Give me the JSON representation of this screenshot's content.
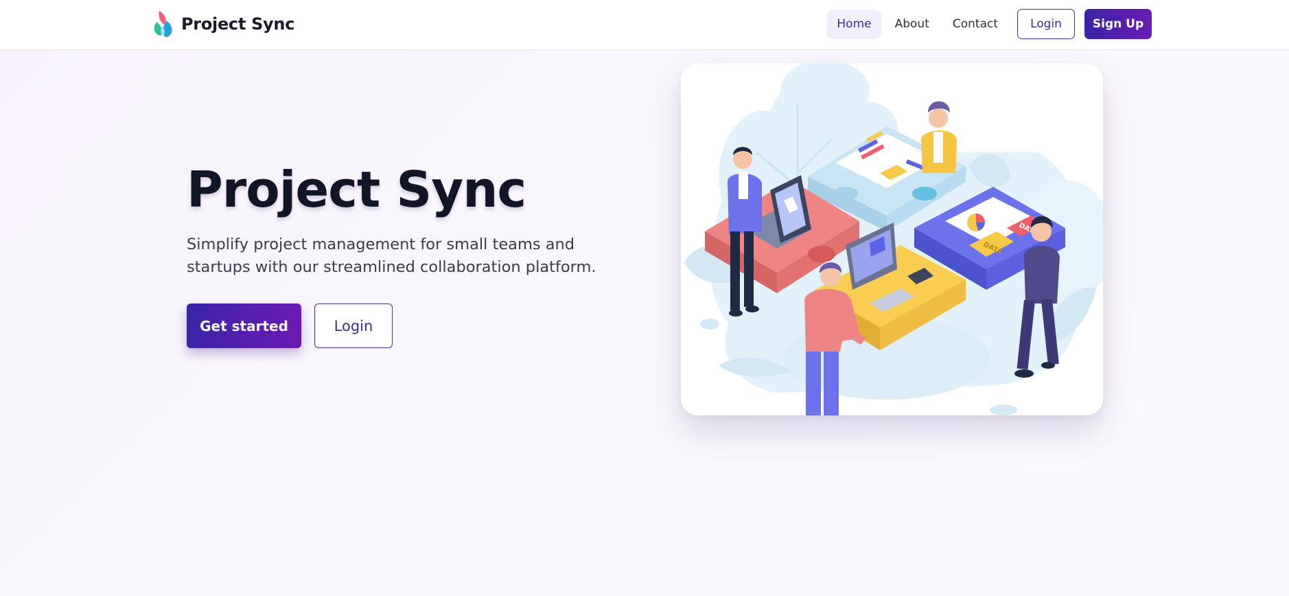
{
  "app": {
    "brand_name": "Project Sync"
  },
  "nav": {
    "links": [
      {
        "label": "Home",
        "active": true
      },
      {
        "label": "About",
        "active": false
      },
      {
        "label": "Contact",
        "active": false
      }
    ],
    "login_label": "Login",
    "signup_label": "Sign Up"
  },
  "hero": {
    "title": "Project Sync",
    "subtitle": "Simplify project management for small teams and startups with our streamlined collaboration platform.",
    "primary_cta": "Get started",
    "secondary_cta": "Login"
  },
  "illustration": {
    "data_labels": [
      "DATA",
      "DATA"
    ]
  },
  "colors": {
    "accent_start": "#3a24a6",
    "accent_end": "#6c1bb3",
    "nav_active_bg": "#eeeffb",
    "heading": "#111526"
  }
}
